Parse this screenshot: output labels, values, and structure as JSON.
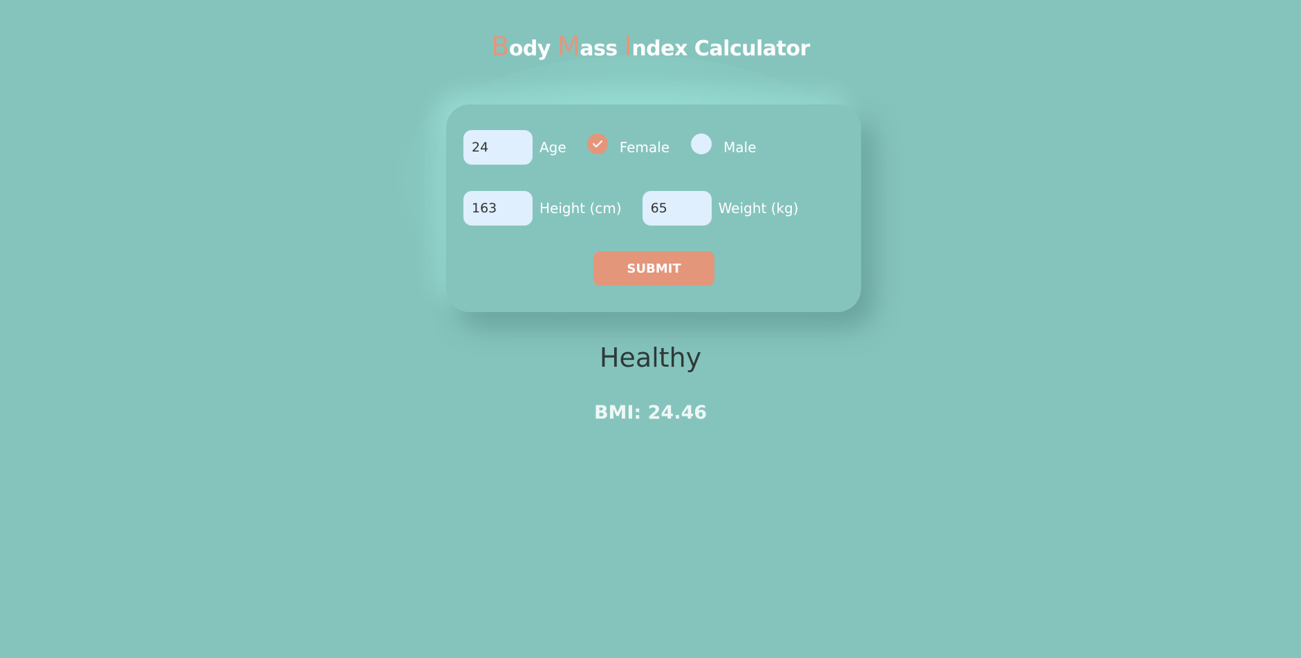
{
  "title": {
    "parts": [
      {
        "accent": "B",
        "rest": "ody "
      },
      {
        "accent": "M",
        "rest": "ass "
      },
      {
        "accent": "I",
        "rest": "ndex Calculator"
      }
    ]
  },
  "form": {
    "age": {
      "value": "24",
      "label": "Age"
    },
    "gender": {
      "female": {
        "label": "Female",
        "checked": true
      },
      "male": {
        "label": "Male",
        "checked": false
      }
    },
    "height": {
      "value": "163",
      "label": "Height (cm)"
    },
    "weight": {
      "value": "65",
      "label": "Weight (kg)"
    },
    "submit_label": "SUBMIT"
  },
  "result": {
    "status": "Healthy",
    "bmi_text": "BMI: 24.46"
  },
  "colors": {
    "background": "#85c4bd",
    "accent": "#e4967b",
    "input_bg": "#dfeffd"
  },
  "icons": {
    "female_radio": "check-icon"
  }
}
